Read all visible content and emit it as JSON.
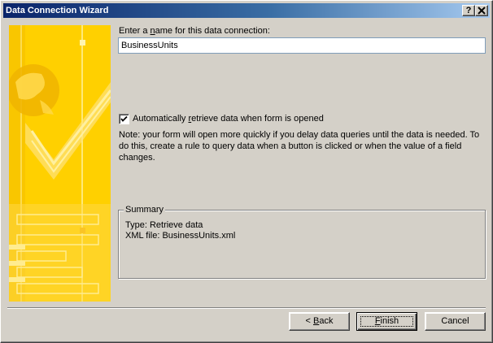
{
  "window": {
    "title": "Data Connection Wizard",
    "help_button": "?",
    "close_button": "X"
  },
  "form": {
    "name_label_before": "Enter a ",
    "name_label_accel": "n",
    "name_label_after": "ame for this data connection:",
    "name_value": "BusinessUnits",
    "auto_retrieve_checked": true,
    "auto_retrieve_before": "Automatically ",
    "auto_retrieve_accel": "r",
    "auto_retrieve_after": "etrieve data when form is opened",
    "note": "Note: your form will open more quickly if you delay data queries until the data is needed. To do this, create a rule to query data when a button is clicked or when the value of a field changes."
  },
  "summary": {
    "legend": "Summary",
    "type_line": "Type: Retrieve data",
    "file_line": "XML file: BusinessUnits.xml"
  },
  "buttons": {
    "back_prefix": "< ",
    "back_accel": "B",
    "back_rest": "ack",
    "finish_accel": "F",
    "finish_rest": "inish",
    "cancel": "Cancel"
  },
  "colors": {
    "titlebar_start": "#0a246a",
    "titlebar_end": "#a6caf0",
    "dialog_face": "#d4d0c8",
    "graphic_yellow": "#ffd700"
  }
}
